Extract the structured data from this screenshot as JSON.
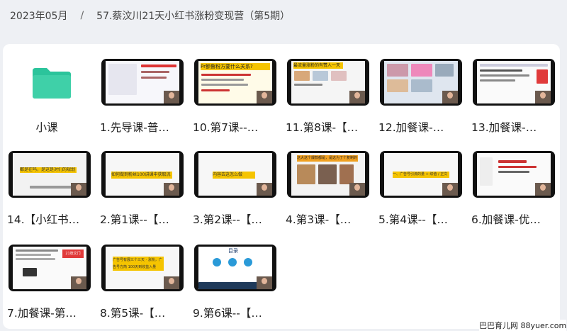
{
  "breadcrumb": {
    "date": "2023年05月",
    "separator": "/",
    "course": "57.蔡汶川21天小红书涨粉变现营（第5期）"
  },
  "items": [
    {
      "label": "小课",
      "type": "folder"
    },
    {
      "label": "1.先导课-普…",
      "type": "video"
    },
    {
      "label": "10.第7课--…",
      "type": "video"
    },
    {
      "label": "11.第8课-【…",
      "type": "video"
    },
    {
      "label": "12.加餐课-…",
      "type": "video"
    },
    {
      "label": "13.加餐课-…",
      "type": "video"
    },
    {
      "label": "14.【小红书…",
      "type": "video"
    },
    {
      "label": "2.第1课--【…",
      "type": "video"
    },
    {
      "label": "3.第2课--【…",
      "type": "video"
    },
    {
      "label": "4.第3课-【…",
      "type": "video"
    },
    {
      "label": "5.第4课--【…",
      "type": "video"
    },
    {
      "label": "6.加餐课-优…",
      "type": "video"
    },
    {
      "label": "7.加餐课-第…",
      "type": "video"
    },
    {
      "label": "8.第5课-【…",
      "type": "video"
    },
    {
      "label": "9.第6课--【…",
      "type": "video"
    }
  ],
  "thumb_texts": {
    "t10_heading": "Pr额鲁粉方要什么关系?",
    "t11_heading": "最流量涨粉的有赞人一天",
    "t2": "如何做到粉丝100讲课中获取流",
    "t3": "内容去这怎么做",
    "t4": "这大这个爆款都是，是这为了个复制的",
    "t5": "一、广告号引流的量 + 绩值 / 正文",
    "t7_badge": "21张文门",
    "t8": "广告号有展三个三天 · 涨粉，广告号方简 100天到收益入量5000",
    "t9_title": "目录",
    "t14": "都是在吗，是这是对们的规划"
  },
  "watermark": "巴巴育儿网 88yuer.com",
  "colors": {
    "folder": "#2bc49b",
    "accent_yellow": "#f5c400",
    "accent_orange": "#f0a020",
    "accent_red": "#e03a3a"
  }
}
